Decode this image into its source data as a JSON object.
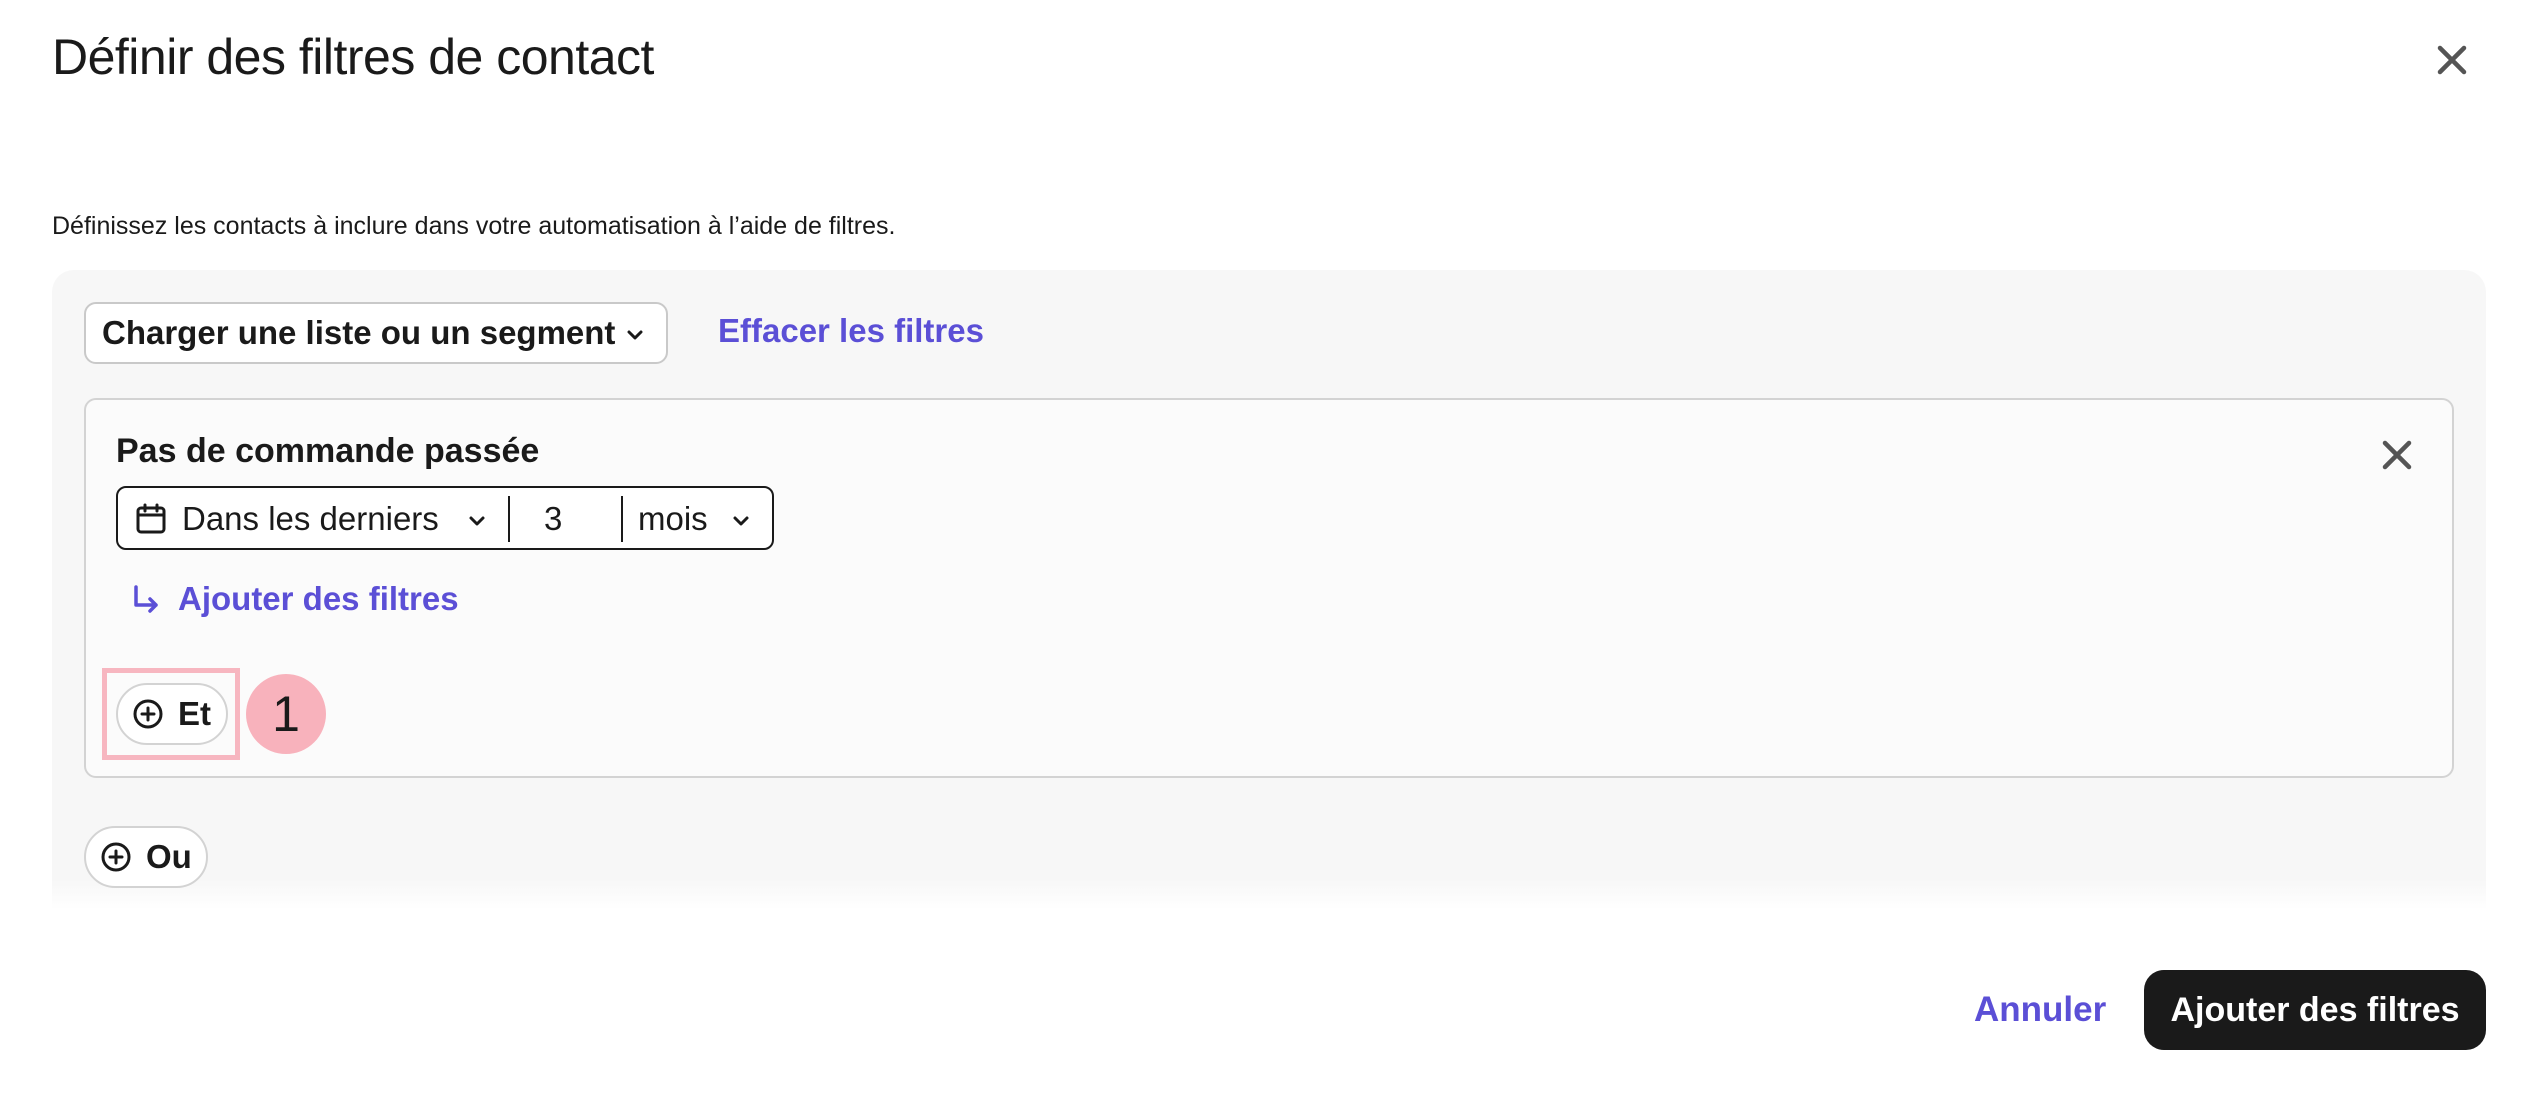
{
  "modal": {
    "title": "Définir des filtres de contact",
    "description": "Définissez les contacts à inclure dans votre automatisation à l’aide de filtres."
  },
  "toolbar": {
    "load_label": "Charger une liste ou un segment",
    "clear_label": "Effacer les filtres"
  },
  "filter": {
    "title": "Pas de commande passée",
    "range_label": "Dans les derniers",
    "amount": "3",
    "unit": "mois",
    "add_sub_label": "Ajouter des filtres",
    "and_label": "Et"
  },
  "annotation": {
    "marker": "1"
  },
  "or_label": "Ou",
  "footer": {
    "cancel_label": "Annuler",
    "submit_label": "Ajouter des filtres"
  },
  "colors": {
    "accent": "#5b4fd6",
    "primary_button": "#1a1a1a",
    "highlight": "#f7b6c0",
    "badge": "#f8b2bc"
  },
  "icons": [
    "close-icon",
    "chevron-down-icon",
    "calendar-icon",
    "sub-arrow-icon",
    "plus-circle-icon"
  ]
}
